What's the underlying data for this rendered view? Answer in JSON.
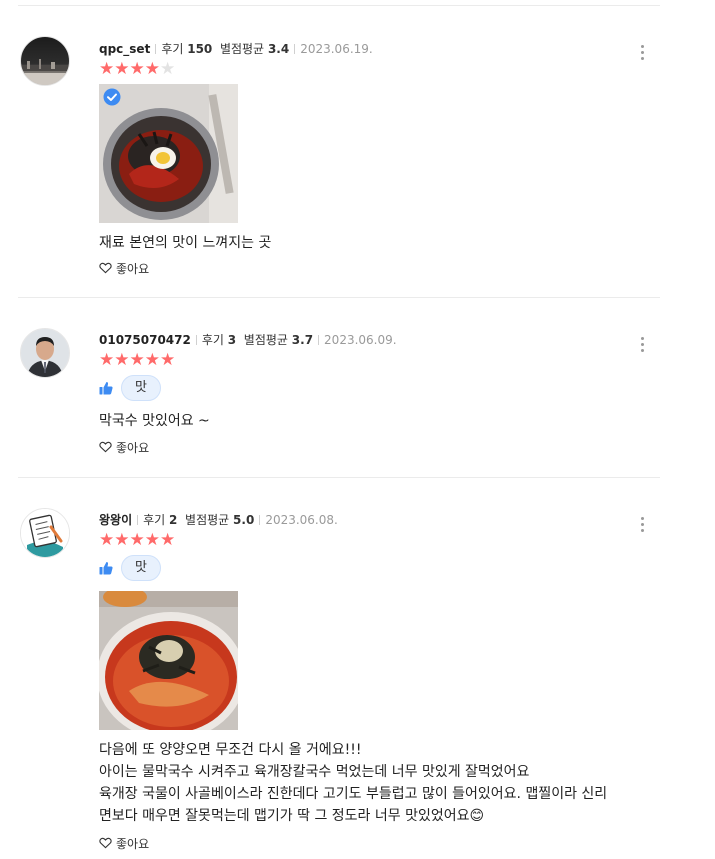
{
  "reviews": [
    {
      "nickname": "qpc_set",
      "review_count_label": "후기",
      "review_count": "150",
      "avg_label": "별점평균",
      "avg": "3.4",
      "date": "2023.06.19.",
      "rating": 4,
      "has_photo": true,
      "photo_verified": true,
      "text": [
        "재료 본연의 맛이 느껴지는 곳"
      ],
      "like_label": "좋아요"
    },
    {
      "nickname": "01075070472",
      "review_count_label": "후기",
      "review_count": "3",
      "avg_label": "별점평균",
      "avg": "3.7",
      "date": "2023.06.09.",
      "rating": 5,
      "tag": "맛",
      "text": [
        "막국수 맛있어요 ~"
      ],
      "like_label": "좋아요"
    },
    {
      "nickname": "왕왕이",
      "review_count_label": "후기",
      "review_count": "2",
      "avg_label": "별점평균",
      "avg": "5.0",
      "date": "2023.06.08.",
      "rating": 5,
      "tag": "맛",
      "has_photo": true,
      "text": [
        "다음에 또 양양오면 무조건 다시 올 거에요!!!",
        "아이는 물막국수 시켜주고 육개장칼국수 먹었는데 너무 맛있게 잘먹었어요",
        "육개장 국물이 사골베이스라 진한데다 고기도 부들럽고 많이 들어있어요. 맵찔이라 신리",
        "면보다 매우면 잘못먹는데 맵기가 딱 그 정도라 너무 맛있었어요😊"
      ],
      "like_label": "좋아요"
    }
  ],
  "colors": {
    "star_on": "#ff6a6a",
    "star_off": "#e3e3e3",
    "tag_bg": "#e8f1fd",
    "thumb": "#3d8bf2",
    "date": "#9a9a9a"
  },
  "icons": {
    "more": "more-vertical-icon",
    "like": "heart-outline-icon",
    "thumb": "thumbs-up-icon",
    "verified": "check-badge-icon"
  }
}
